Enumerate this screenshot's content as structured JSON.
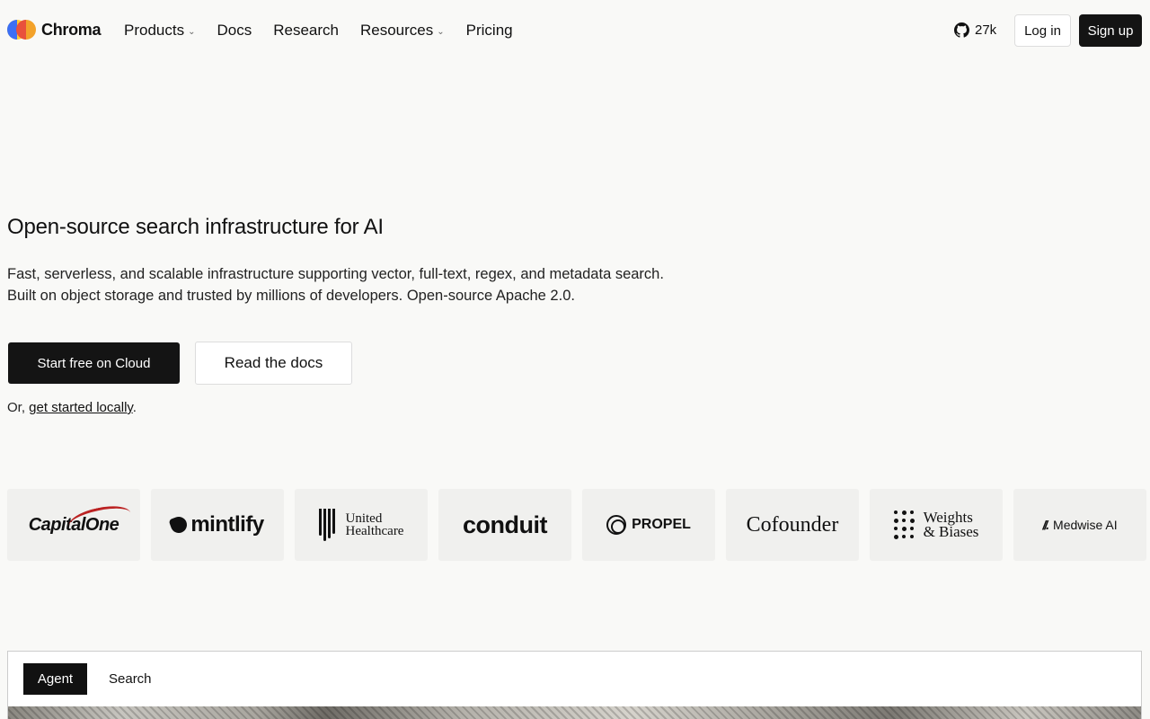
{
  "nav": {
    "brand": "Chroma",
    "menu": [
      {
        "label": "Products",
        "has_dropdown": true
      },
      {
        "label": "Docs",
        "has_dropdown": false
      },
      {
        "label": "Research",
        "has_dropdown": false
      },
      {
        "label": "Resources",
        "has_dropdown": true
      },
      {
        "label": "Pricing",
        "has_dropdown": false
      }
    ],
    "github_stars": "27k",
    "login": "Log in",
    "signup": "Sign up"
  },
  "hero": {
    "title": "Open-source search infrastructure for AI",
    "subtitle": "Fast, serverless, and scalable infrastructure supporting vector, full-text, regex, and metadata search. Built on object storage and trusted by millions of developers. Open-source Apache 2.0.",
    "cta_primary": "Start free on Cloud",
    "cta_secondary": "Read the docs",
    "or_prefix": "Or, ",
    "or_link": "get started locally",
    "or_suffix": "."
  },
  "logos": [
    {
      "name": "Capital One",
      "lines": [
        "Capital",
        "One"
      ]
    },
    {
      "name": "mintlify"
    },
    {
      "name": "United Healthcare",
      "lines": [
        "United",
        "Healthcare"
      ]
    },
    {
      "name": "conduit"
    },
    {
      "name": "PROPEL"
    },
    {
      "name": "Cofounder"
    },
    {
      "name": "Weights & Biases",
      "lines": [
        "Weights",
        "& Biases"
      ]
    },
    {
      "name": "Medwise AI"
    }
  ],
  "demo": {
    "tabs": [
      "Agent",
      "Search"
    ],
    "active_tab": "Agent"
  },
  "colors": {
    "background": "#f9f9f7",
    "primary_button": "#141414",
    "card": "#f0f0ee"
  }
}
